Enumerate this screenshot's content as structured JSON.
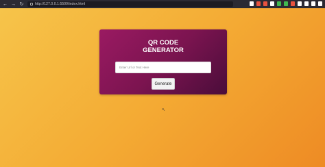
{
  "browser": {
    "url": "http://127.0.0.1:5500/index.html",
    "nav_icons": [
      "back-icon",
      "forward-icon",
      "reload-icon",
      "home-icon"
    ],
    "extension_colors": [
      "#ffffff",
      "#e8533f",
      "#e8533f",
      "#ffffff",
      "#3fb950",
      "#3fb950",
      "#e8533f",
      "#ffffff",
      "#ffffff",
      "#ffffff",
      "#ffffff"
    ]
  },
  "page": {
    "background_gradient": [
      "#f6c44a",
      "#ee8b24"
    ],
    "card": {
      "title_line1": "QR CODE",
      "title_line2": "GENERATOR",
      "input_placeholder": "Enter Url or Text Here",
      "input_value": "",
      "button_label": "Generate",
      "gradient": [
        "#9a1a62",
        "#4a0d3a"
      ]
    }
  }
}
